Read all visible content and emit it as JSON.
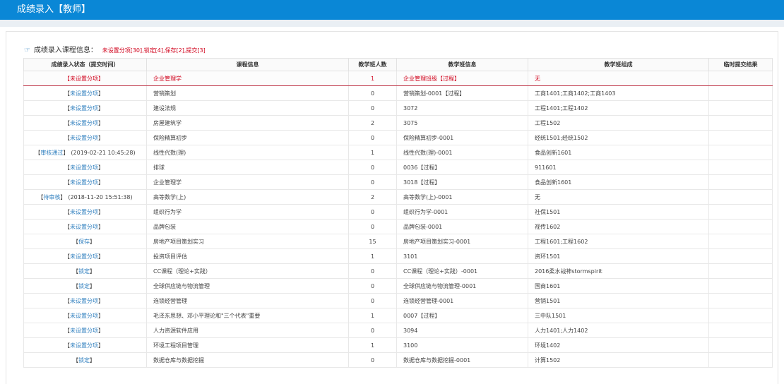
{
  "header": {
    "title": "成绩录入【教师】"
  },
  "info": {
    "label": "成绩录入课程信息：",
    "summary": "未设置分项[30],锁定[4],保存[2],提交[3]"
  },
  "table": {
    "columns": [
      "成绩录入状态（提交时间）",
      "课程信息",
      "教学班人数",
      "教学班信息",
      "教学班组成",
      "临时提交结果"
    ],
    "rows": [
      {
        "status_pre": "【",
        "status_link": "未设置分项",
        "status_post": "】",
        "time": "",
        "course": "企业管理学",
        "count": "1",
        "class_info": "企业管理班级【过程】",
        "composition": "无",
        "result": ""
      },
      {
        "status_pre": "【",
        "status_link": "未设置分项",
        "status_post": "】",
        "time": "",
        "course": "营销策划",
        "count": "0",
        "class_info": "营销策划-0001【过程】",
        "composition": "工商1401;工商1402;工商1403",
        "result": ""
      },
      {
        "status_pre": "【",
        "status_link": "未设置分项",
        "status_post": "】",
        "time": "",
        "course": "建设法规",
        "count": "0",
        "class_info": "3072",
        "composition": "工程1401;工程1402",
        "result": ""
      },
      {
        "status_pre": "【",
        "status_link": "未设置分项",
        "status_post": "】",
        "time": "",
        "course": "房屋建筑学",
        "count": "2",
        "class_info": "3075",
        "composition": "工程1502",
        "result": ""
      },
      {
        "status_pre": "【",
        "status_link": "未设置分项",
        "status_post": "】",
        "time": "",
        "course": "保险精算初步",
        "count": "0",
        "class_info": "保险精算初步-0001",
        "composition": "经统1501;经统1502",
        "result": ""
      },
      {
        "status_pre": "【",
        "status_link": "审核通过",
        "status_post": "】",
        "time": "(2019-02-21 10:45:28)",
        "course": "线性代数(理)",
        "count": "1",
        "class_info": "线性代数(理)-0001",
        "composition": "食品创新1601",
        "result": ""
      },
      {
        "status_pre": "【",
        "status_link": "未设置分项",
        "status_post": "】",
        "time": "",
        "course": "排球",
        "count": "0",
        "class_info": "0036【过程】",
        "composition": "911601",
        "result": ""
      },
      {
        "status_pre": "【",
        "status_link": "未设置分项",
        "status_post": "】",
        "time": "",
        "course": "企业管理学",
        "count": "0",
        "class_info": "3018【过程】",
        "composition": "食品创新1601",
        "result": ""
      },
      {
        "status_pre": "【",
        "status_link": "待审核",
        "status_post": "】",
        "time": "(2018-11-20 15:51:38)",
        "course": "高等数学(上)",
        "count": "2",
        "class_info": "高等数学(上)-0001",
        "composition": "无",
        "result": ""
      },
      {
        "status_pre": "【",
        "status_link": "未设置分项",
        "status_post": "】",
        "time": "",
        "course": "组织行为学",
        "count": "0",
        "class_info": "组织行为学-0001",
        "composition": "社保1501",
        "result": ""
      },
      {
        "status_pre": "【",
        "status_link": "未设置分项",
        "status_post": "】",
        "time": "",
        "course": "品牌包装",
        "count": "0",
        "class_info": "品牌包装-0001",
        "composition": "视传1602",
        "result": ""
      },
      {
        "status_pre": "【",
        "status_link": "保存",
        "status_post": "】",
        "time": "",
        "course": "房地产项目策划实习",
        "count": "15",
        "class_info": "房地产项目策划实习-0001",
        "composition": "工程1601;工程1602",
        "result": ""
      },
      {
        "status_pre": "【",
        "status_link": "未设置分项",
        "status_post": "】",
        "time": "",
        "course": "投资项目评估",
        "count": "1",
        "class_info": "3101",
        "composition": "资环1501",
        "result": ""
      },
      {
        "status_pre": "【",
        "status_link": "锁定",
        "status_post": "】",
        "time": "",
        "course": "CC课程（理论+实践）",
        "count": "0",
        "class_info": "CC课程（理论+实践）-0001",
        "composition": "2016柔水战神stormspirit",
        "result": ""
      },
      {
        "status_pre": "【",
        "status_link": "锁定",
        "status_post": "】",
        "time": "",
        "course": "全球供应链与物流管理",
        "count": "0",
        "class_info": "全球供应链与物流管理-0001",
        "composition": "国商1601",
        "result": ""
      },
      {
        "status_pre": "【",
        "status_link": "未设置分项",
        "status_post": "】",
        "time": "",
        "course": "连锁经营管理",
        "count": "0",
        "class_info": "连锁经营管理-0001",
        "composition": "营销1501",
        "result": ""
      },
      {
        "status_pre": "【",
        "status_link": "未设置分项",
        "status_post": "】",
        "time": "",
        "course": "毛泽东思想、邓小平理论和\"三个代表\"重要",
        "count": "1",
        "class_info": "0007【过程】",
        "composition": "三中队1501",
        "result": ""
      },
      {
        "status_pre": "【",
        "status_link": "未设置分项",
        "status_post": "】",
        "time": "",
        "course": "人力资源软件应用",
        "count": "0",
        "class_info": "3094",
        "composition": "人力1401;人力1402",
        "result": ""
      },
      {
        "status_pre": "【",
        "status_link": "未设置分项",
        "status_post": "】",
        "time": "",
        "course": "环境工程项目管理",
        "count": "1",
        "class_info": "3100",
        "composition": "环境1402",
        "result": ""
      },
      {
        "status_pre": "【",
        "status_link": "锁定",
        "status_post": "】",
        "time": "",
        "course": "数据仓库与数据挖掘",
        "count": "0",
        "class_info": "数据仓库与数据挖掘-0001",
        "composition": "计算1502",
        "result": ""
      }
    ]
  },
  "colors": {
    "header": "#0a87d6",
    "accent_red": "#d0021b",
    "link_blue": "#2f7fbf"
  },
  "icons": {
    "info_icon": "hand-pointer-icon"
  }
}
